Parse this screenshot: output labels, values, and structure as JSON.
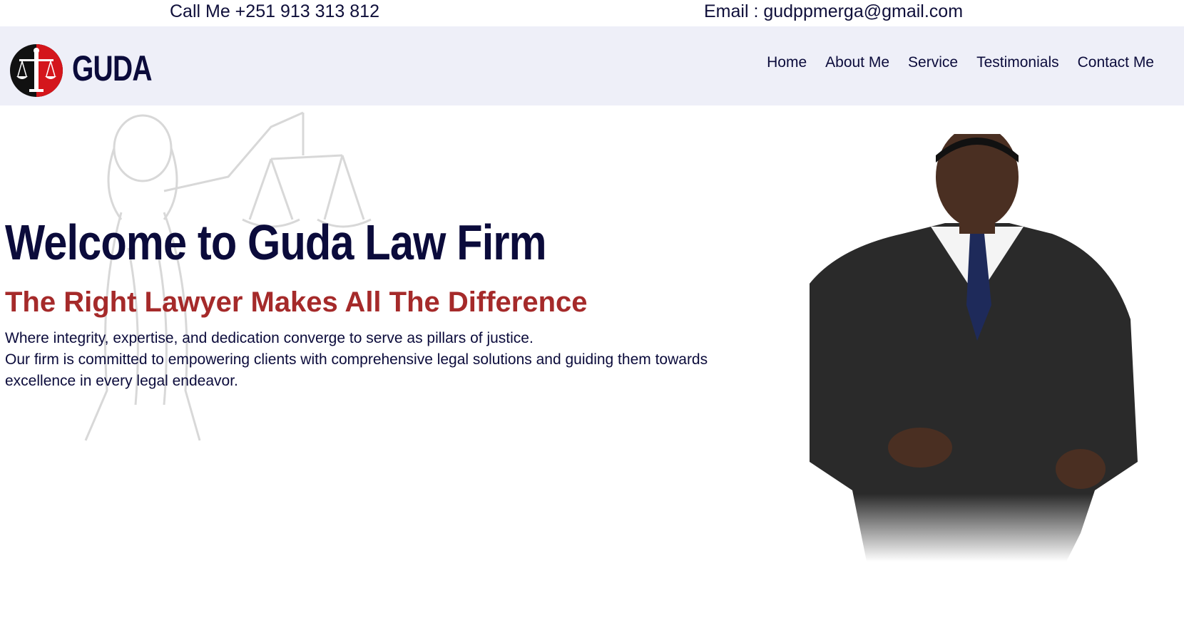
{
  "topbar": {
    "phone": "Call Me +251 913 313 812",
    "email": "Email : gudppmerga@gmail.com"
  },
  "brand": {
    "name": "GUDA",
    "logo_icon": "scales-of-justice-icon"
  },
  "nav": {
    "items": [
      "Home",
      "About Me",
      "Service",
      "Testimonials",
      "Contact Me"
    ]
  },
  "hero": {
    "title": "Welcome to Guda Law Firm",
    "subtitle": "The Right Lawyer Makes All The Difference",
    "line1": "Where integrity, expertise, and dedication converge to serve as pillars of justice.",
    "line2": "Our firm is committed to empowering clients with comprehensive legal solutions and guiding them towards excellence in every legal endeavor."
  },
  "colors": {
    "navy": "#0b0b3b",
    "accent_red": "#a52a2a",
    "nav_bg": "#eeeff8"
  }
}
